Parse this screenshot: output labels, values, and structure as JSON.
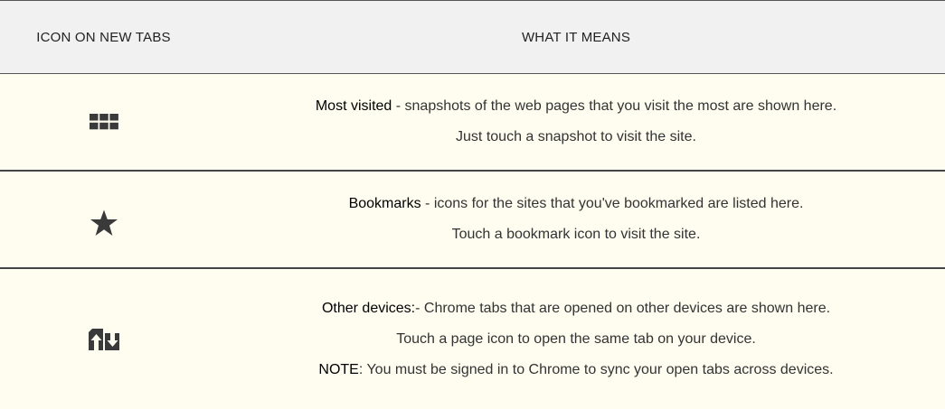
{
  "header": {
    "icon_col": "ICON ON NEW TABS",
    "desc_col": "WHAT IT MEANS"
  },
  "rows": [
    {
      "icon": "grid-icon",
      "term": "Most visited",
      "line1_rest": " - snapshots of the web pages that you visit the most are shown here.",
      "line2": "Just touch a snapshot to visit the site."
    },
    {
      "icon": "star-icon",
      "term": "Bookmarks",
      "line1_rest": " - icons for the sites that you've bookmarked are listed here.",
      "line2": "Touch a bookmark icon to visit the site."
    },
    {
      "icon": "other-devices-icon",
      "term": "Other devices:",
      "line1_rest": "- Chrome tabs that are opened on other devices are shown here.",
      "line2": "Touch a page icon to open the same tab on your device.",
      "note_label": "NOTE",
      "note_rest": ": You must be signed in to Chrome to sync your open tabs across devices."
    }
  ],
  "colors": {
    "header_bg": "#f1f1f1",
    "row_bg": "#fffdf0",
    "icon": "#3a3a3a",
    "border": "#444444"
  }
}
